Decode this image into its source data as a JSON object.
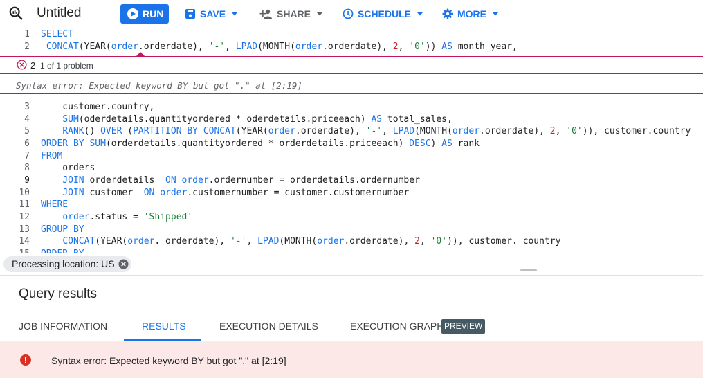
{
  "header": {
    "title": "Untitled",
    "run_label": "RUN",
    "save_label": "SAVE",
    "share_label": "SHARE",
    "schedule_label": "SCHEDULE",
    "more_label": "MORE"
  },
  "editor": {
    "lines": [
      {
        "n": "1",
        "tokens": [
          {
            "t": "SELECT",
            "c": "kw"
          }
        ]
      },
      {
        "n": "2",
        "tokens": [
          {
            "t": " CONCAT",
            "c": "kw"
          },
          {
            "t": "(YEAR(",
            "c": ""
          },
          {
            "t": "order",
            "c": "kw"
          },
          {
            "t": ".orderdate), ",
            "c": ""
          },
          {
            "t": "'-'",
            "c": "str"
          },
          {
            "t": ", ",
            "c": ""
          },
          {
            "t": "LPAD",
            "c": "kw"
          },
          {
            "t": "(MONTH(",
            "c": ""
          },
          {
            "t": "order",
            "c": "kw"
          },
          {
            "t": ".orderdate), ",
            "c": ""
          },
          {
            "t": "2",
            "c": "num"
          },
          {
            "t": ", ",
            "c": ""
          },
          {
            "t": "'0'",
            "c": "str"
          },
          {
            "t": ")) ",
            "c": ""
          },
          {
            "t": "AS",
            "c": "kw"
          },
          {
            "t": " month_year,",
            "c": ""
          }
        ]
      },
      {
        "n": "3",
        "tokens": [
          {
            "t": "    customer.country,",
            "c": ""
          }
        ]
      },
      {
        "n": "4",
        "tokens": [
          {
            "t": "    ",
            "c": ""
          },
          {
            "t": "SUM",
            "c": "kw"
          },
          {
            "t": "(oderdetails.quantityordered * oderdetails.priceeach) ",
            "c": ""
          },
          {
            "t": "AS",
            "c": "kw"
          },
          {
            "t": " total_sales,",
            "c": ""
          }
        ]
      },
      {
        "n": "5",
        "tokens": [
          {
            "t": "    ",
            "c": ""
          },
          {
            "t": "RANK",
            "c": "kw"
          },
          {
            "t": "() ",
            "c": ""
          },
          {
            "t": "OVER",
            "c": "kw"
          },
          {
            "t": " (",
            "c": ""
          },
          {
            "t": "PARTITION BY CONCAT",
            "c": "kw"
          },
          {
            "t": "(YEAR(",
            "c": ""
          },
          {
            "t": "order",
            "c": "kw"
          },
          {
            "t": ".orderdate), ",
            "c": ""
          },
          {
            "t": "'-'",
            "c": "str"
          },
          {
            "t": ", ",
            "c": ""
          },
          {
            "t": "LPAD",
            "c": "kw"
          },
          {
            "t": "(MONTH(",
            "c": ""
          },
          {
            "t": "order",
            "c": "kw"
          },
          {
            "t": ".orderdate), ",
            "c": ""
          },
          {
            "t": "2",
            "c": "num"
          },
          {
            "t": ", ",
            "c": ""
          },
          {
            "t": "'0'",
            "c": "str"
          },
          {
            "t": ")), customer.country",
            "c": ""
          }
        ]
      },
      {
        "n": "6",
        "tokens": [
          {
            "t": "ORDER BY",
            "c": "kw"
          },
          {
            "t": " ",
            "c": ""
          },
          {
            "t": "SUM",
            "c": "kw"
          },
          {
            "t": "(orderdetails.quantityordered * orderdetails.priceeach) ",
            "c": ""
          },
          {
            "t": "DESC",
            "c": "kw"
          },
          {
            "t": ") ",
            "c": ""
          },
          {
            "t": "AS",
            "c": "kw"
          },
          {
            "t": " rank",
            "c": ""
          }
        ]
      },
      {
        "n": "7",
        "tokens": [
          {
            "t": "FROM",
            "c": "kw"
          }
        ]
      },
      {
        "n": "8",
        "tokens": [
          {
            "t": "    orders",
            "c": ""
          }
        ]
      },
      {
        "n": "9",
        "tokens": [
          {
            "t": "    ",
            "c": ""
          },
          {
            "t": "JOIN",
            "c": "kw"
          },
          {
            "t": " orderdetails  ",
            "c": ""
          },
          {
            "t": "ON",
            "c": "kw"
          },
          {
            "t": " ",
            "c": ""
          },
          {
            "t": "order",
            "c": "kw"
          },
          {
            "t": ".ordernumber = orderdetails.ordernumber",
            "c": ""
          }
        ]
      },
      {
        "n": "10",
        "tokens": [
          {
            "t": "    ",
            "c": ""
          },
          {
            "t": "JOIN",
            "c": "kw"
          },
          {
            "t": " customer  ",
            "c": ""
          },
          {
            "t": "ON",
            "c": "kw"
          },
          {
            "t": " ",
            "c": ""
          },
          {
            "t": "order",
            "c": "kw"
          },
          {
            "t": ".customernumber = customer.customernumber",
            "c": ""
          }
        ]
      },
      {
        "n": "11",
        "tokens": [
          {
            "t": "WHERE",
            "c": "kw"
          }
        ]
      },
      {
        "n": "12",
        "tokens": [
          {
            "t": "    ",
            "c": ""
          },
          {
            "t": "order",
            "c": "kw"
          },
          {
            "t": ".status = ",
            "c": ""
          },
          {
            "t": "'Shipped'",
            "c": "str"
          }
        ]
      },
      {
        "n": "13",
        "tokens": [
          {
            "t": "GROUP BY",
            "c": "kw"
          }
        ]
      },
      {
        "n": "14",
        "tokens": [
          {
            "t": "    ",
            "c": ""
          },
          {
            "t": "CONCAT",
            "c": "kw"
          },
          {
            "t": "(YEAR(",
            "c": ""
          },
          {
            "t": "order",
            "c": "kw"
          },
          {
            "t": ". orderdate), ",
            "c": ""
          },
          {
            "t": "'-'",
            "c": "str"
          },
          {
            "t": ", ",
            "c": ""
          },
          {
            "t": "LPAD",
            "c": "kw"
          },
          {
            "t": "(MONTH(",
            "c": ""
          },
          {
            "t": "order",
            "c": "kw"
          },
          {
            "t": ".orderdate), ",
            "c": ""
          },
          {
            "t": "2",
            "c": "num"
          },
          {
            "t": ", ",
            "c": ""
          },
          {
            "t": "'0'",
            "c": "str"
          },
          {
            "t": ")), customer. country",
            "c": ""
          }
        ]
      },
      {
        "n": "15",
        "tokens": [
          {
            "t": "ORDER BY",
            "c": "kw"
          }
        ]
      }
    ]
  },
  "problem": {
    "count": "2",
    "summary": "1 of 1 problem",
    "message": "Syntax error: Expected keyword BY but got \".\" at [2:19]"
  },
  "location_chip": "Processing location: US",
  "results": {
    "title": "Query results",
    "tabs": [
      "JOB INFORMATION",
      "RESULTS",
      "EXECUTION DETAILS",
      "EXECUTION GRAPH"
    ],
    "preview_badge": "PREVIEW",
    "error_text": "Syntax error: Expected keyword BY but got \".\" at [2:19]"
  }
}
